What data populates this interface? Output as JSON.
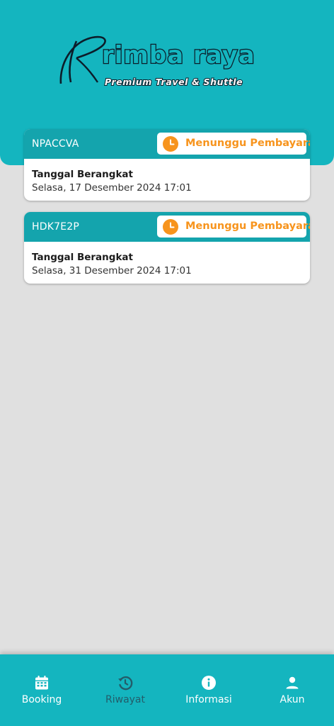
{
  "brand": {
    "name": "rimba raya",
    "tagline": "Premium Travel & Shuttle"
  },
  "bookings": [
    {
      "code": "NPACCVA",
      "status": "Menunggu Pembayaran",
      "departure_label": "Tanggal Berangkat",
      "departure_value": "Selasa, 17 Desember 2024 17:01"
    },
    {
      "code": "HDK7E2P",
      "status": "Menunggu Pembayaran",
      "departure_label": "Tanggal Berangkat",
      "departure_value": "Selasa, 31 Desember 2024 17:01"
    }
  ],
  "nav": [
    {
      "label": "Booking",
      "icon": "calendar-icon"
    },
    {
      "label": "Riwayat",
      "icon": "history-icon",
      "active": true
    },
    {
      "label": "Informasi",
      "icon": "info-icon"
    },
    {
      "label": "Akun",
      "icon": "person-icon"
    }
  ],
  "colors": {
    "primary": "#14b5bf",
    "card_header": "#14a4ad",
    "status_orange": "#f7941d",
    "nav_active": "#235d6a"
  }
}
